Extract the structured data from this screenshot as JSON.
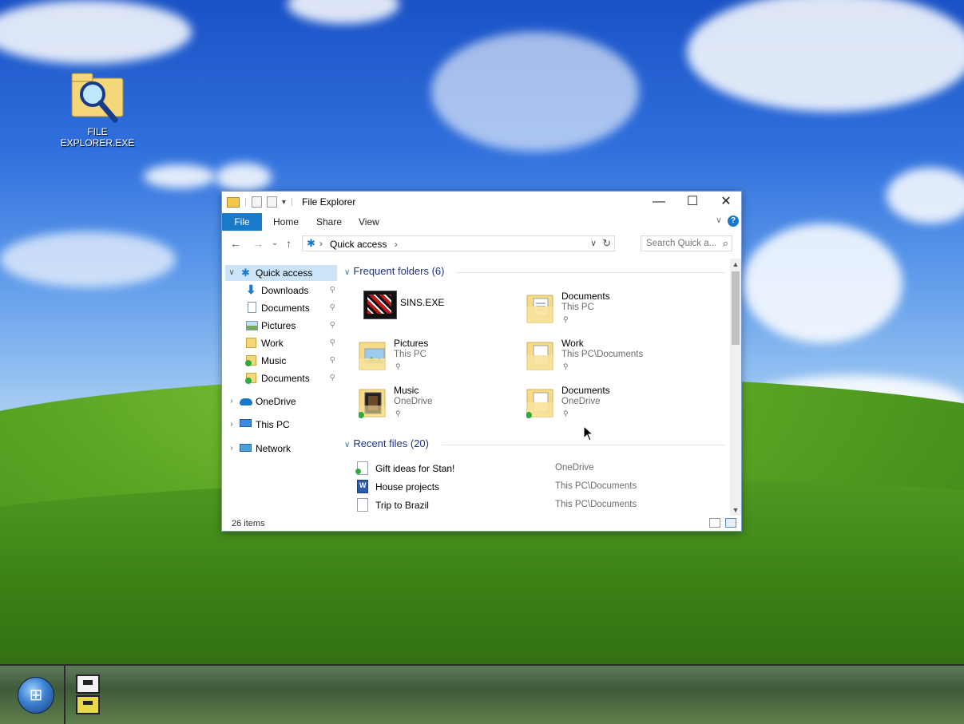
{
  "desktop": {
    "icon_label": "FILE EXPLORER.EXE"
  },
  "window": {
    "title": "File Explorer",
    "buttons": {
      "minimize": "—",
      "maximize": "☐",
      "close": "✕"
    },
    "tabs": {
      "file": "File",
      "home": "Home",
      "share": "Share",
      "view": "View"
    },
    "help": "?",
    "address": {
      "location": "Quick access",
      "separator": "›"
    },
    "search": {
      "placeholder": "Search Quick a..."
    }
  },
  "navpane": {
    "quick_access": "Quick access",
    "items": [
      {
        "label": "Downloads",
        "icon": "download-arrow-icon"
      },
      {
        "label": "Documents",
        "icon": "documents-icon"
      },
      {
        "label": "Pictures",
        "icon": "pictures-icon"
      },
      {
        "label": "Work",
        "icon": "folder-icon"
      },
      {
        "label": "Music",
        "icon": "music-folder-synced-icon"
      },
      {
        "label": "Documents",
        "icon": "documents-folder-synced-icon"
      }
    ],
    "onedrive": "OneDrive",
    "this_pc": "This PC",
    "network": "Network"
  },
  "frequent": {
    "heading": "Frequent folders (6)",
    "items": [
      {
        "name": "SINS.EXE",
        "sub": ""
      },
      {
        "name": "Documents",
        "sub": "This PC"
      },
      {
        "name": "Pictures",
        "sub": "This PC"
      },
      {
        "name": "Work",
        "sub": "This PC\\Documents"
      },
      {
        "name": "Music",
        "sub": "OneDrive"
      },
      {
        "name": "Documents",
        "sub": "OneDrive"
      }
    ]
  },
  "recent": {
    "heading": "Recent files (20)",
    "items": [
      {
        "name": "Gift ideas for Stan!",
        "location": "OneDrive"
      },
      {
        "name": "House projects",
        "location": "This PC\\Documents"
      },
      {
        "name": "Trip to Brazil",
        "location": "This PC\\Documents"
      }
    ]
  },
  "status": {
    "item_count": "26 items"
  },
  "colors": {
    "accent": "#1979ca",
    "selection": "#cce4f7",
    "heading": "#1e3287"
  }
}
